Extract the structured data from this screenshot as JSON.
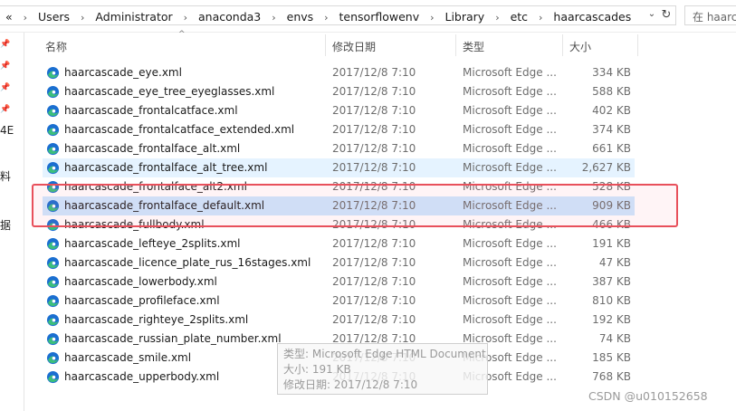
{
  "address_bar": {
    "back_glyph": "«",
    "crumbs": [
      "Users",
      "Administrator",
      "anaconda3",
      "envs",
      "tensorflowenv",
      "Library",
      "etc",
      "haarcascades"
    ],
    "search_placeholder": "在 haarc"
  },
  "left_pane": {
    "fragments": [
      "4E",
      "料",
      "据"
    ]
  },
  "columns": {
    "name": "名称",
    "date": "修改日期",
    "type": "类型",
    "size": "大小"
  },
  "files": [
    {
      "name": "haarcascade_eye.xml",
      "date": "2017/12/8 7:10",
      "type": "Microsoft Edge ...",
      "size": "334 KB"
    },
    {
      "name": "haarcascade_eye_tree_eyeglasses.xml",
      "date": "2017/12/8 7:10",
      "type": "Microsoft Edge ...",
      "size": "588 KB"
    },
    {
      "name": "haarcascade_frontalcatface.xml",
      "date": "2017/12/8 7:10",
      "type": "Microsoft Edge ...",
      "size": "402 KB"
    },
    {
      "name": "haarcascade_frontalcatface_extended.xml",
      "date": "2017/12/8 7:10",
      "type": "Microsoft Edge ...",
      "size": "374 KB"
    },
    {
      "name": "haarcascade_frontalface_alt.xml",
      "date": "2017/12/8 7:10",
      "type": "Microsoft Edge ...",
      "size": "661 KB"
    },
    {
      "name": "haarcascade_frontalface_alt_tree.xml",
      "date": "2017/12/8 7:10",
      "type": "Microsoft Edge ...",
      "size": "2,627 KB",
      "state": "hover"
    },
    {
      "name": "haarcascade_frontalface_alt2.xml",
      "date": "2017/12/8 7:10",
      "type": "Microsoft Edge ...",
      "size": "528 KB"
    },
    {
      "name": "haarcascade_frontalface_default.xml",
      "date": "2017/12/8 7:10",
      "type": "Microsoft Edge ...",
      "size": "909 KB",
      "state": "selected"
    },
    {
      "name": "haarcascade_fullbody.xml",
      "date": "2017/12/8 7:10",
      "type": "Microsoft Edge ...",
      "size": "466 KB"
    },
    {
      "name": "haarcascade_lefteye_2splits.xml",
      "date": "2017/12/8 7:10",
      "type": "Microsoft Edge ...",
      "size": "191 KB"
    },
    {
      "name": "haarcascade_licence_plate_rus_16stages.xml",
      "date": "2017/12/8 7:10",
      "type": "Microsoft Edge ...",
      "size": "47 KB"
    },
    {
      "name": "haarcascade_lowerbody.xml",
      "date": "2017/12/8 7:10",
      "type": "Microsoft Edge ...",
      "size": "387 KB"
    },
    {
      "name": "haarcascade_profileface.xml",
      "date": "2017/12/8 7:10",
      "type": "Microsoft Edge ...",
      "size": "810 KB"
    },
    {
      "name": "haarcascade_righteye_2splits.xml",
      "date": "2017/12/8 7:10",
      "type": "Microsoft Edge ...",
      "size": "192 KB"
    },
    {
      "name": "haarcascade_russian_plate_number.xml",
      "date": "2017/12/8 7:10",
      "type": "Microsoft Edge ...",
      "size": "74 KB"
    },
    {
      "name": "haarcascade_smile.xml",
      "date": "2017/12/8 7:10",
      "type": "Microsoft Edge ...",
      "size": "185 KB"
    },
    {
      "name": "haarcascade_upperbody.xml",
      "date": "2017/12/8 7:10",
      "type": "Microsoft Edge ...",
      "size": "768 KB"
    }
  ],
  "tooltip": {
    "type_line": "类型: Microsoft Edge HTML Document",
    "size_line": "大小: 191 KB",
    "date_line": "修改日期: 2017/12/8 7:10"
  },
  "watermark": "CSDN @u010152658",
  "colors": {
    "hover": "#e5f3ff",
    "selected": "#cce8ff",
    "highlight_border": "#e8505b",
    "edge_icon_blue": "#1b6fd1",
    "edge_icon_green": "#3cc07a"
  },
  "icons": {
    "file": "edge-html-file-icon",
    "refresh": "refresh-icon",
    "dropdown": "chevron-down-icon",
    "pin": "pin-icon"
  }
}
